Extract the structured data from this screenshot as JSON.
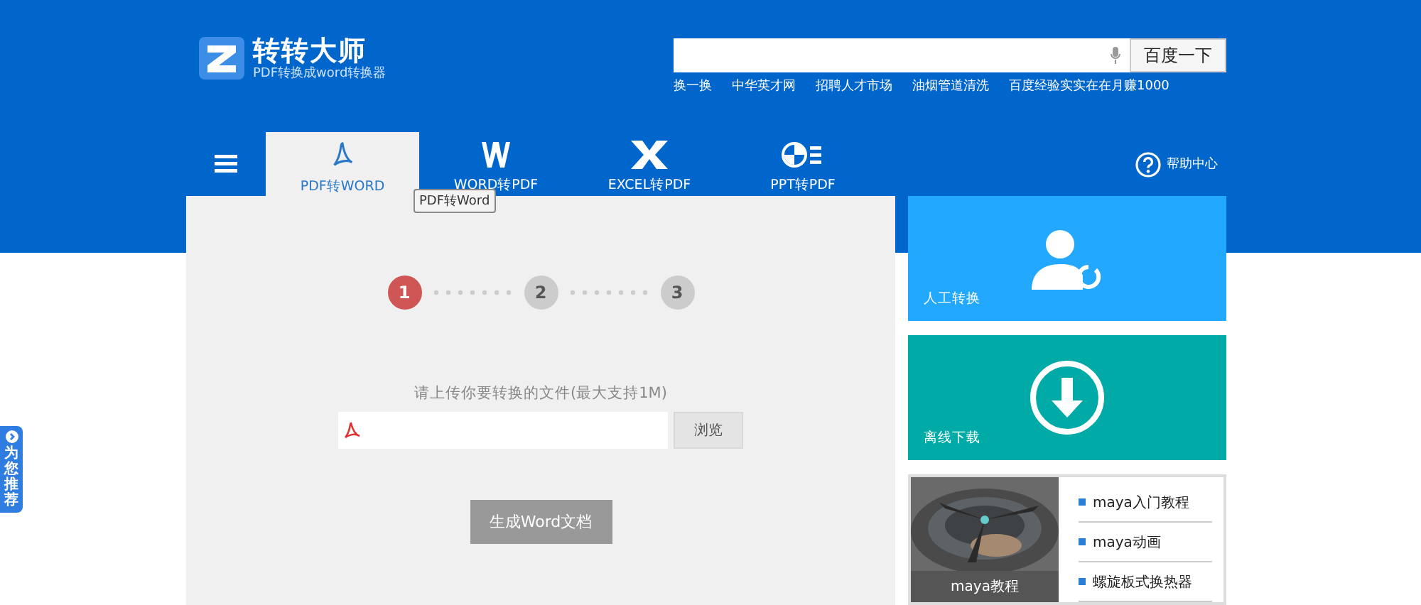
{
  "logo": {
    "title": "转转大师",
    "subtitle": "PDF转换成word转换器"
  },
  "search": {
    "button": "百度一下"
  },
  "hot_links": [
    "换一换",
    "中华英才网",
    "招聘人才市场",
    "油烟管道清洗",
    "百度经验实实在在月赚1000"
  ],
  "nav": {
    "tabs": [
      {
        "label": "PDF转WORD",
        "kind": "pdf",
        "selected": true
      },
      {
        "label": "WORD转PDF",
        "kind": "word",
        "selected": false
      },
      {
        "label": "EXCEL转PDF",
        "kind": "excel",
        "selected": false
      },
      {
        "label": "PPT转PDF",
        "kind": "ppt",
        "selected": false
      }
    ],
    "tooltip": "PDF转Word",
    "help": "帮助中心"
  },
  "steps": [
    {
      "label": "1",
      "selected": true
    },
    {
      "label": "2",
      "selected": false
    },
    {
      "label": "3",
      "selected": false
    }
  ],
  "upload": {
    "prompt": "请上传你要转换的文件(最大支持1M)",
    "browse": "浏览",
    "generate": "生成Word文档"
  },
  "tiles": [
    {
      "label": "人工转换",
      "kind": "manual"
    },
    {
      "label": "离线下载",
      "kind": "download"
    }
  ],
  "tutorial": {
    "caption": "maya教程",
    "links": [
      "maya入门教程",
      "maya动画",
      "螺旋板式换热器"
    ]
  },
  "side_tab": {
    "label": "为您推荐"
  }
}
